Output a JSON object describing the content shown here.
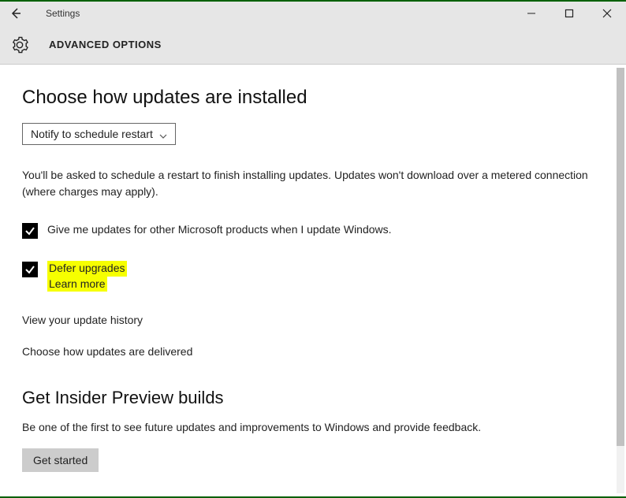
{
  "window": {
    "title": "Settings"
  },
  "header": {
    "heading": "ADVANCED OPTIONS"
  },
  "main": {
    "section1_title": "Choose how updates are installed",
    "dropdown_value": "Notify to schedule restart",
    "schedule_text": "You'll be asked to schedule a restart to finish installing updates. Updates won't download over a metered connection (where charges may apply).",
    "checkbox1_label": "Give me updates for other Microsoft products when I update Windows.",
    "defer_label": "Defer upgrades",
    "learn_more": "Learn more",
    "link_history": "View your update history",
    "link_delivered": "Choose how updates are delivered",
    "section2_title": "Get Insider Preview builds",
    "section2_text": "Be one of the first to see future updates and improvements to Windows and provide feedback.",
    "get_started": "Get started"
  }
}
